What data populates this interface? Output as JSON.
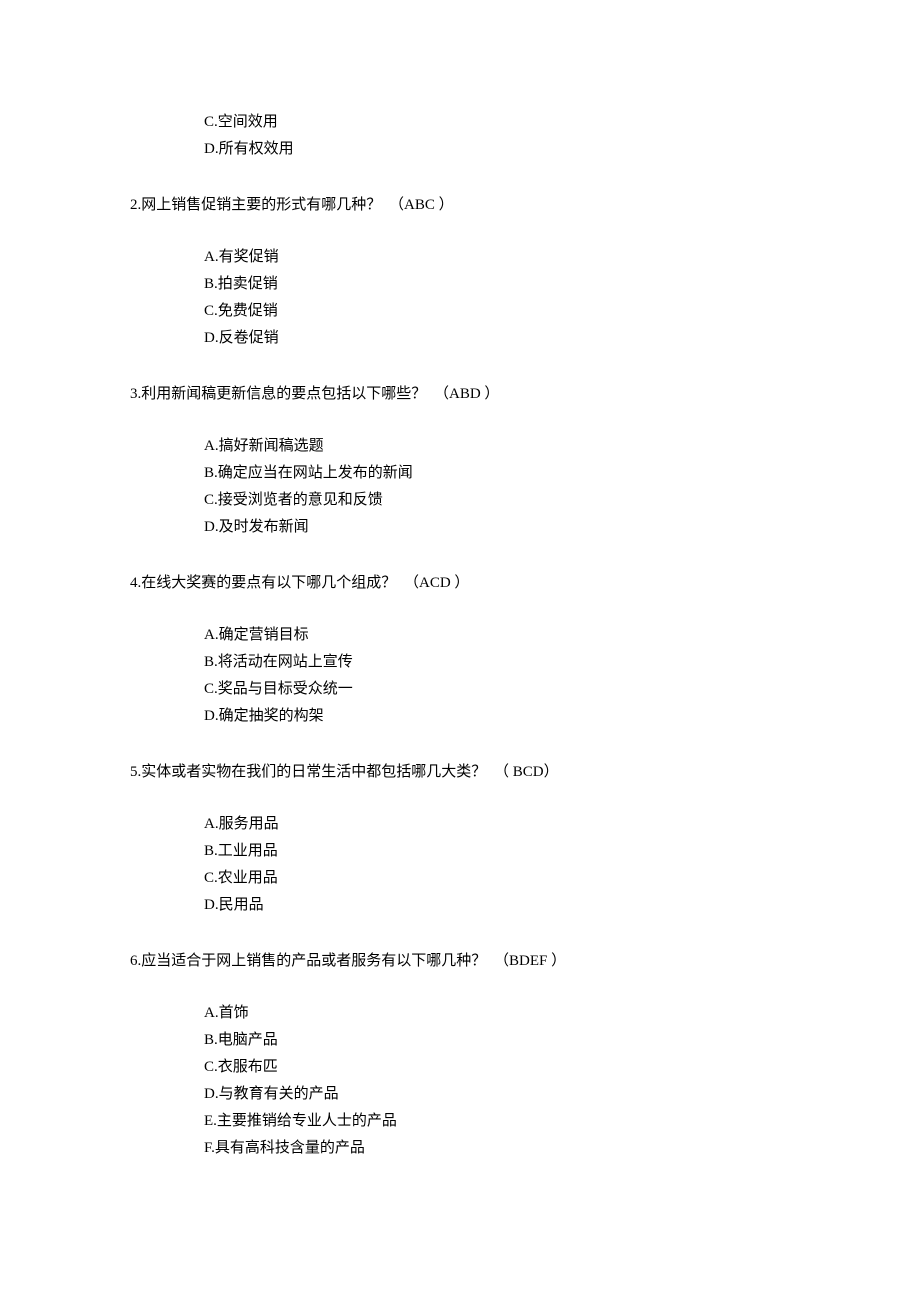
{
  "q1_partial_options": {
    "c": "C.空间效用",
    "d": "D.所有权效用"
  },
  "q2": {
    "text": "2.网上销售促销主要的形式有哪几种？",
    "answer": "（ABC ）",
    "options": {
      "a": "A.有奖促销",
      "b": "B.拍卖促销",
      "c": "C.免费促销",
      "d": "D.反卷促销"
    }
  },
  "q3": {
    "text": "3.利用新闻稿更新信息的要点包括以下哪些？",
    "answer": "（ABD ）",
    "options": {
      "a": "A.搞好新闻稿选题",
      "b": "B.确定应当在网站上发布的新闻",
      "c": "C.接受浏览者的意见和反馈",
      "d": "D.及时发布新闻"
    }
  },
  "q4": {
    "text": "4.在线大奖赛的要点有以下哪几个组成？",
    "answer": "（ACD ）",
    "options": {
      "a": "A.确定营销目标",
      "b": "B.将活动在网站上宣传",
      "c": "C.奖品与目标受众统一",
      "d": "D.确定抽奖的构架"
    }
  },
  "q5": {
    "text": "5.实体或者实物在我们的日常生活中都包括哪几大类？",
    "answer": "（ BCD）",
    "options": {
      "a": "A.服务用品",
      "b": "B.工业用品",
      "c": "C.农业用品",
      "d": "D.民用品"
    }
  },
  "q6": {
    "text": "6.应当适合于网上销售的产品或者服务有以下哪几种？",
    "answer": "（BDEF ）",
    "options": {
      "a": "A.首饰",
      "b": "B.电脑产品",
      "c": "C.衣服布匹",
      "d": "D.与教育有关的产品",
      "e": "E.主要推销给专业人士的产品",
      "f": "F.具有高科技含量的产品"
    }
  }
}
